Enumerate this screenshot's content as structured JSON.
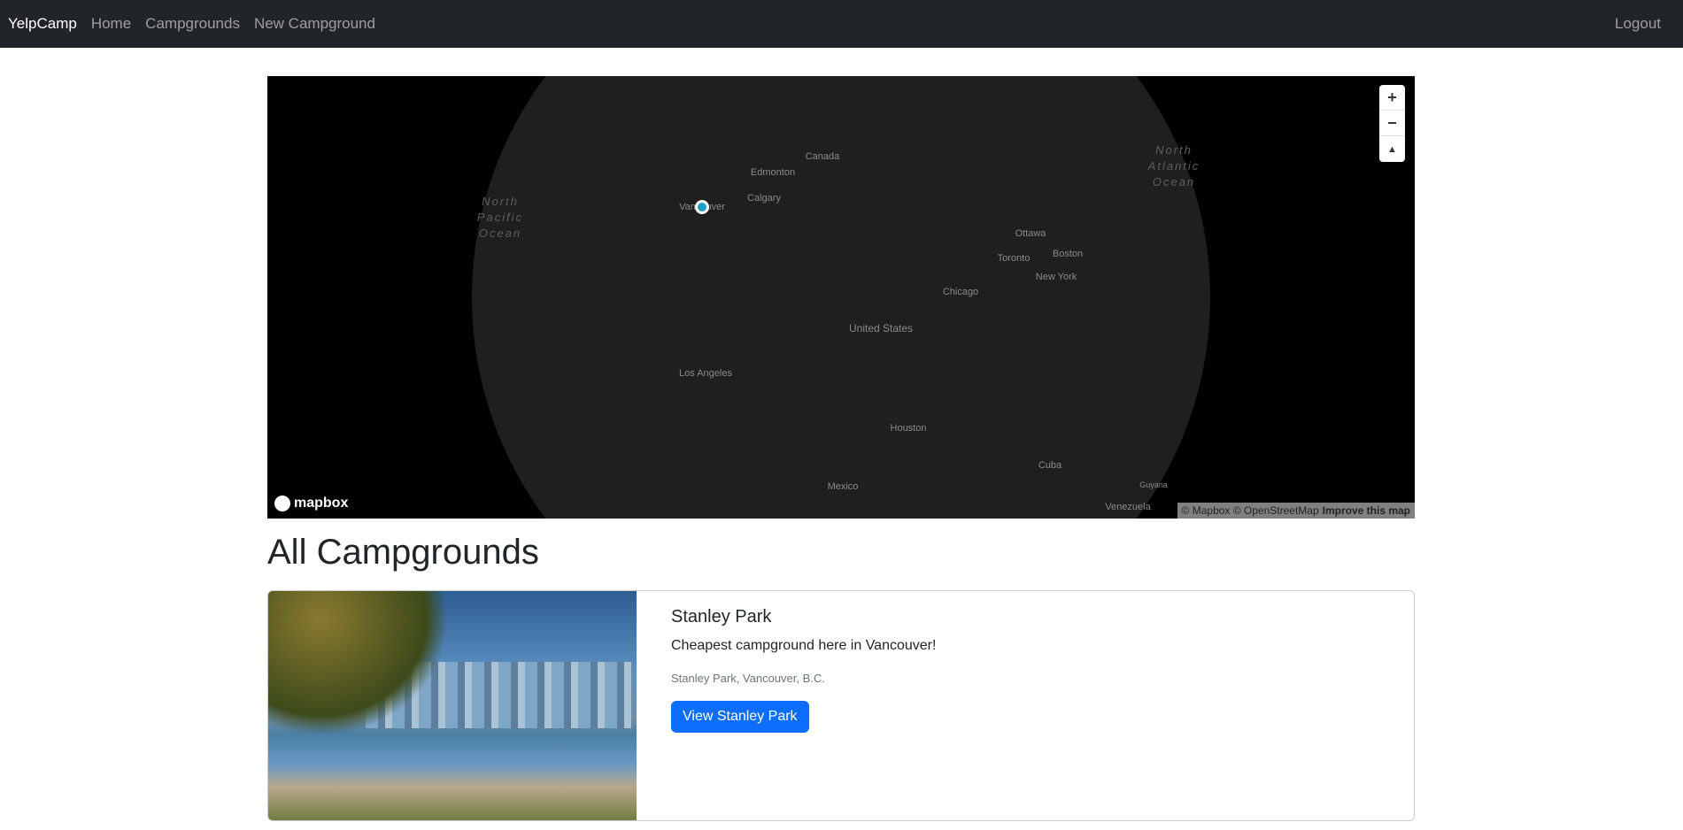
{
  "nav": {
    "brand": "YelpCamp",
    "links": [
      "Home",
      "Campgrounds",
      "New Campground"
    ],
    "logout": "Logout"
  },
  "map": {
    "labels": {
      "canada": "Canada",
      "edmonton": "Edmonton",
      "calgary": "Calgary",
      "vancouver": "Vancouver",
      "ottawa": "Ottawa",
      "toronto": "Toronto",
      "boston": "Boston",
      "newyork": "New York",
      "chicago": "Chicago",
      "us": "United States",
      "la": "Los Angeles",
      "houston": "Houston",
      "cuba": "Cuba",
      "mexico": "Mexico",
      "guyana": "Guyana",
      "venezuela": "Venezuela",
      "npo": "North Pacific Ocean",
      "nao": "North Atlantic Ocean"
    },
    "controls": {
      "zoom_in": "+",
      "zoom_out": "−",
      "compass": "▲"
    },
    "logo": "mapbox",
    "attribution": "© Mapbox © OpenStreetMap",
    "improve": "Improve this map",
    "marker_color": "#1aa0c8"
  },
  "heading": "All Campgrounds",
  "campgrounds": [
    {
      "title": "Stanley Park",
      "description": "Cheapest campground here in Vancouver!",
      "location": "Stanley Park, Vancouver, B.C.",
      "button": "View Stanley Park"
    }
  ]
}
